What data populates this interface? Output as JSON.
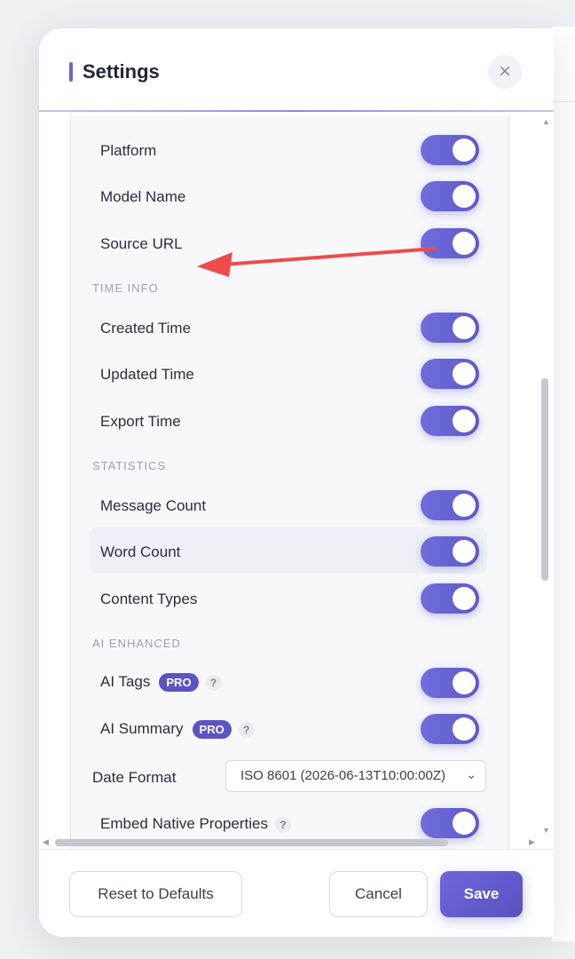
{
  "header": {
    "title": "Settings"
  },
  "rows_top": [
    {
      "label": "Platform"
    },
    {
      "label": "Model Name"
    },
    {
      "label": "Source URL"
    }
  ],
  "sections": {
    "time_info": "TIME INFO",
    "statistics": "STATISTICS",
    "ai_enhanced": "AI ENHANCED"
  },
  "time_rows": [
    {
      "label": "Created Time"
    },
    {
      "label": "Updated Time"
    },
    {
      "label": "Export Time"
    }
  ],
  "stat_rows": [
    {
      "label": "Message Count"
    },
    {
      "label": "Word Count"
    },
    {
      "label": "Content Types"
    }
  ],
  "ai_rows": [
    {
      "label": "AI Tags",
      "badge": "PRO",
      "help": "?"
    },
    {
      "label": "AI Summary",
      "badge": "PRO",
      "help": "?"
    }
  ],
  "date_format": {
    "label": "Date Format",
    "value": "ISO 8601 (2026-06-13T10:00:00Z)"
  },
  "embed": {
    "label": "Embed Native Properties",
    "help": "?"
  },
  "footer": {
    "reset_label": "Reset to Defaults",
    "cancel_label": "Cancel",
    "save_label": "Save"
  },
  "colors": {
    "accent": "#6c63d8",
    "annotation_arrow": "#ef4b4b"
  },
  "icons": {
    "close": "close-icon",
    "chevron": "chevron-down-icon"
  }
}
